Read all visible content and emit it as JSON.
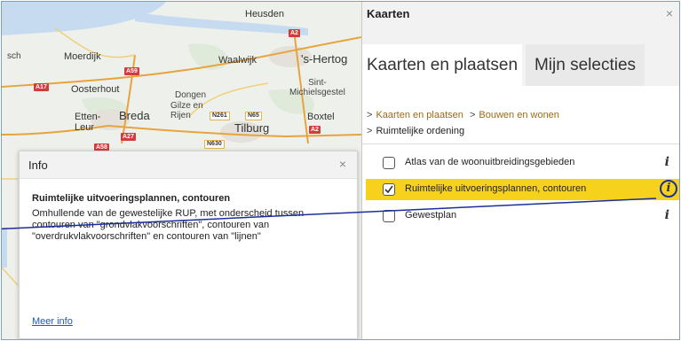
{
  "map": {
    "labels": {
      "heusden": "Heusden",
      "moerdijk": "Moerdijk",
      "waalwijk": "Waalwijk",
      "shertog": "'s-Hertog",
      "sintmichielsgestel": "Sint-\nMichielsgestel",
      "oosterhout": "Oosterhout",
      "dongen": "Dongen",
      "gilzeenrijen": "Gilze en\nRijen",
      "breda": "Breda",
      "ettenleur": "Etten-\nLeur",
      "boxtel": "Boxtel",
      "tilburg": "Tilburg",
      "sch": "sch"
    },
    "shields": {
      "a59": "A59",
      "a17": "A17",
      "a27": "A27",
      "a2top": "A2",
      "a2": "A2",
      "a58": "A58",
      "n261": "N261",
      "n65": "N65",
      "n630": "N630"
    }
  },
  "info_popup": {
    "title": "Info",
    "close": "×",
    "heading": "Ruimtelijke uitvoeringsplannen, contouren",
    "description": "Omhullende van de gewestelijke RUP, met onderscheid tussen contouren van \"grondvlakvoorschriften\", contouren van \"overdrukvlakvoorschriften\" en contouren van \"lijnen\"",
    "more_link": "Meer info"
  },
  "panel": {
    "title": "Kaarten",
    "close": "×",
    "tabs": [
      {
        "label": "Kaarten en plaatsen",
        "active": true
      },
      {
        "label": "Mijn selecties",
        "active": false
      }
    ],
    "breadcrumb": {
      "sep": ">",
      "items": [
        "Kaarten en plaatsen",
        "Bouwen en wonen"
      ],
      "current": "Ruimtelijke ordening"
    },
    "layers": [
      {
        "label": "Atlas van de woonuitbreidingsgebieden",
        "checked": false,
        "selected": false,
        "info": "i"
      },
      {
        "label": "Ruimtelijke uitvoeringsplannen, contouren",
        "checked": true,
        "selected": true,
        "info": "i"
      },
      {
        "label": "Gewestplan",
        "checked": false,
        "selected": false,
        "info": "i"
      }
    ]
  },
  "colors": {
    "highlight": "#f7d21c",
    "link": "#1c5bb6",
    "breadcrumb_link": "#9a6b14",
    "annotation": "#1b2f9c",
    "road_shield": "#d43c3c"
  }
}
